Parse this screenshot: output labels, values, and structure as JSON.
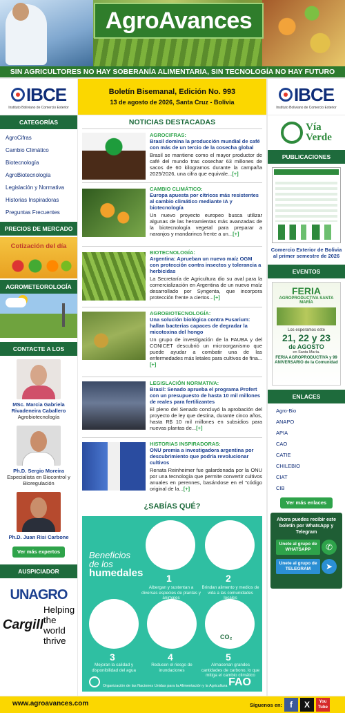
{
  "header": {
    "brand": "AgroAvances",
    "slogan": "SIN AGRICULTORES NO HAY SOBERANÍA ALIMENTARIA, SIN TECNOLOGÍA NO HAY FUTURO",
    "ibce_logo": "IBCE",
    "ibce_sub": "Instituto Boliviano de Comercio Exterior",
    "bulletin_title": "Boletín Bisemanal, Edición No. 993",
    "bulletin_date": "13 de agosto de 2026, Santa Cruz - Bolivia"
  },
  "left": {
    "categories_title": "CATEGORÍAS",
    "categories": [
      "AgroCifras",
      "Cambio Climático",
      "Biotecnología",
      "AgroBiotecnología",
      "Legislación y Normativa",
      "Historias Inspiradoras",
      "Preguntas Frecuentes"
    ],
    "prices_title": "PRECIOS DE MERCADO",
    "prices_img": "Cotización del día",
    "meteo_title": "AGROMETEOROLOGÍA",
    "experts_title": "CONTACTE A LOS EXPERTOS",
    "experts": [
      {
        "name": "MSc. Marcia Gabriela Rivadeneira Caballero",
        "spec": "Agrobiotecnología"
      },
      {
        "name": "Ph.D. Sergio Moreira",
        "spec": "Especialista en Biocontrol y Bioregulación"
      },
      {
        "name": "Ph.D. Juan Risi Carbone",
        "spec": ""
      }
    ],
    "experts_button": "Ver más expertos",
    "sponsor_title": "AUSPICIADOR",
    "sponsor1": "UNAGRO",
    "sponsor2": "Cargill",
    "sponsor2_tag": "Helping the world thrive"
  },
  "main": {
    "title": "NOTICIAS DESTACADAS",
    "articles": [
      {
        "cat": "AGROCIFRAS:",
        "head": "Brasil domina la producción mundial de café con más de un tercio de la cosecha global",
        "body": "Brasil se mantiene como el mayor productor de café del mundo tras cosechar 63 millones de sacos de 60 kilogramos durante la campaña 2025/2026, una cifra que equivale...",
        "more": "[+]"
      },
      {
        "cat": "CAMBIO CLIMÁTICO:",
        "head": "Europa apuesta por cítricos más resistentes al cambio climático mediante IA y biotecnología",
        "body": "Un nuevo proyecto europeo busca utilizar algunas de las herramientas más avanzadas de la biotecnología vegetal para preparar a naranjos y mandarinos frente a un...",
        "more": "[+]"
      },
      {
        "cat": "BIOTECNOLOGÍA:",
        "head": "Argentina: Aprueban un nuevo maíz OGM con protección contra insectos y tolerancia a herbicidas",
        "body": "La Secretaría de Agricultura dio su aval para la comercialización en Argentina de un nuevo maíz desarrollado por Syngenta, que incorpora protección frente a ciertos...",
        "more": "[+]"
      },
      {
        "cat": "AGROBIOTECNOLOGÍA:",
        "head": "Una solución biológica contra Fusarium: hallan bacterias capaces de degradar la micotoxina del hongo",
        "body": "Un grupo de investigación de la FAUBA y del CONICET descubrió un microorganismo que puede ayudar a combatir una de las enfermedades más letales para cultivos de fina...",
        "more": "[+]"
      },
      {
        "cat": "LEGISLACIÓN NORMATIVA:",
        "head": "Brasil: Senado aprueba el programa Profert con un presupuesto de hasta 10 mil millones de reales para fertilizantes",
        "body": "El pleno del Senado concluyó la aprobación del proyecto de ley que destina, durante cinco años, hasta R$ 10 mil millones en subsidios para nuevas plantas de...",
        "more": "[+]"
      },
      {
        "cat": "HISTORIAS INSPIRADORAS:",
        "head": "ONU premia a investigadora argentina por descubrimiento que podría revolucionar cultivos",
        "body": "Renata Reinheimer fue galardonada por la ONU por una tecnología que permite convertir cultivos anuales en perennes, basándose en el \"código original de la...",
        "more": "[+]"
      }
    ],
    "sabias_title": "¿SABÍAS QUÉ?",
    "fao": {
      "title_line1": "Beneficios",
      "title_line2": "de los",
      "title_line3": "humedales",
      "items": [
        {
          "n": "1",
          "t": "Albergan y sustentan a diversas especies de plantas y animales"
        },
        {
          "n": "2",
          "t": "Brindan alimento y medios de vida a las comunidades locales"
        },
        {
          "n": "3",
          "t": "Mejoran la calidad y disponibilidad del agua"
        },
        {
          "n": "4",
          "t": "Reducen el riesgo de inundaciones"
        },
        {
          "n": "5",
          "t": "Almacenan grandes cantidades de carbono, lo que mitiga el cambio climático"
        }
      ],
      "co2": "CO₂",
      "org": "Organización de las Naciones Unidas para la Alimentación y la Agricultura",
      "logo": "FAO"
    }
  },
  "right": {
    "ibce_logo": "IBCE",
    "ibce_sub": "Instituto Boliviano de Comercio Exterior",
    "via_verde_l1": "Vía",
    "via_verde_l2": "Verde",
    "publications_title": "PUBLICACIONES",
    "publication_caption": "Comercio Exterior de Bolivia al primer semestre de 2026",
    "events_title": "EVENTOS",
    "event": {
      "l1": "FERIA",
      "l2": "AGROPRODUCTIVA SANTA MARÍA",
      "l3": "Los esperamos este",
      "l4": "21, 22 y 23",
      "l5": "de AGOSTO",
      "l6": "en Santa María.",
      "l7": "FERIA AGROPRODUCTIVA y 99 ANIVERSARIO de la Comunidad"
    },
    "links_title": "ENLACES",
    "links": [
      "Agro-Bio",
      "ANAPO",
      "APIA",
      "CAO",
      "CATIE",
      "CHILEBIO",
      "CIAT",
      "CIB"
    ],
    "links_button": "Ver más enlaces",
    "whatsapp_text": "Ahora puedes recibir este boletín por WhatsApp y Telegram",
    "wa_btn": "Unete al grupo de WHATSAPP",
    "tg_btn": "Unete al grupo de TELEGRAM"
  },
  "footer": {
    "url": "www.agroavances.com",
    "follow": "Síguenos en:",
    "social": [
      "f",
      "X",
      "You Tube"
    ]
  },
  "colors": {
    "green": "#1e6b3c",
    "yellow": "#fbd700",
    "blue": "#1b3f8f",
    "teal": "#2fbfa2"
  }
}
